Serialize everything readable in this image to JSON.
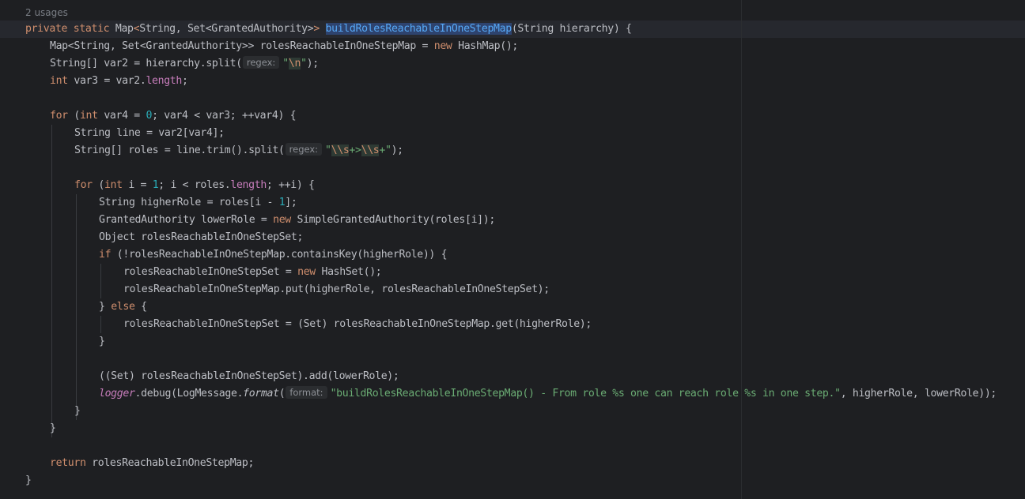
{
  "editor": {
    "usages_hint": "2 usages",
    "lines": [
      {
        "indent": 0,
        "segments": [
          {
            "t": "private",
            "c": "kw"
          },
          {
            "t": " "
          },
          {
            "t": "static",
            "c": "kw"
          },
          {
            "t": " Map"
          },
          {
            "t": "<",
            "c": "kw"
          },
          {
            "t": "String, Set<GrantedAuthority>"
          },
          {
            "t": ">",
            "c": "kw"
          },
          {
            "t": " "
          },
          {
            "t": "buildRolesReachableInOneStepMap",
            "c": "fn-hl"
          },
          {
            "t": "(String hierarchy) {"
          }
        ]
      },
      {
        "indent": 1,
        "segments": [
          {
            "t": "Map<String, Set<GrantedAuthority>> rolesReachableInOneStepMap = "
          },
          {
            "t": "new",
            "c": "kw"
          },
          {
            "t": " HashMap();"
          }
        ]
      },
      {
        "indent": 1,
        "segments": [
          {
            "t": "String[] var2 = hierarchy.split("
          },
          {
            "t": "regex:",
            "c": "hint"
          },
          {
            "t": "\"",
            "c": "str"
          },
          {
            "t": "\\n",
            "c": "esc"
          },
          {
            "t": "\"",
            "c": "str"
          },
          {
            "t": ");"
          }
        ]
      },
      {
        "indent": 1,
        "segments": [
          {
            "t": "int",
            "c": "kw"
          },
          {
            "t": " var3 = var2."
          },
          {
            "t": "length",
            "c": "fld"
          },
          {
            "t": ";"
          }
        ]
      },
      {
        "indent": 0,
        "segments": []
      },
      {
        "indent": 1,
        "segments": [
          {
            "t": "for",
            "c": "kw"
          },
          {
            "t": " ("
          },
          {
            "t": "int",
            "c": "kw"
          },
          {
            "t": " var4 = "
          },
          {
            "t": "0",
            "c": "num"
          },
          {
            "t": "; var4 < var3; ++var4) {"
          }
        ]
      },
      {
        "indent": 2,
        "segments": [
          {
            "t": "String line = var2[var4];"
          }
        ]
      },
      {
        "indent": 2,
        "segments": [
          {
            "t": "String[] roles = line.trim().split("
          },
          {
            "t": "regex:",
            "c": "hint"
          },
          {
            "t": "\"",
            "c": "str"
          },
          {
            "t": "\\\\s",
            "c": "esc"
          },
          {
            "t": "+>",
            "c": "str"
          },
          {
            "t": "\\\\s",
            "c": "esc"
          },
          {
            "t": "+\"",
            "c": "str"
          },
          {
            "t": ");"
          }
        ]
      },
      {
        "indent": 0,
        "segments": []
      },
      {
        "indent": 2,
        "segments": [
          {
            "t": "for",
            "c": "kw"
          },
          {
            "t": " ("
          },
          {
            "t": "int",
            "c": "kw"
          },
          {
            "t": " i = "
          },
          {
            "t": "1",
            "c": "num"
          },
          {
            "t": "; i < roles."
          },
          {
            "t": "length",
            "c": "fld"
          },
          {
            "t": "; ++i) {"
          }
        ]
      },
      {
        "indent": 3,
        "segments": [
          {
            "t": "String higherRole = roles[i - "
          },
          {
            "t": "1",
            "c": "num"
          },
          {
            "t": "];"
          }
        ]
      },
      {
        "indent": 3,
        "segments": [
          {
            "t": "GrantedAuthority lowerRole = "
          },
          {
            "t": "new",
            "c": "kw"
          },
          {
            "t": " SimpleGrantedAuthority(roles[i]);"
          }
        ]
      },
      {
        "indent": 3,
        "segments": [
          {
            "t": "Object rolesReachableInOneStepSet;"
          }
        ]
      },
      {
        "indent": 3,
        "segments": [
          {
            "t": "if",
            "c": "kw"
          },
          {
            "t": " (!rolesReachableInOneStepMap.containsKey(higherRole)) {"
          }
        ]
      },
      {
        "indent": 4,
        "segments": [
          {
            "t": "rolesReachableInOneStepSet = "
          },
          {
            "t": "new",
            "c": "kw"
          },
          {
            "t": " HashSet();"
          }
        ]
      },
      {
        "indent": 4,
        "segments": [
          {
            "t": "rolesReachableInOneStepMap.put(higherRole, rolesReachableInOneStepSet);"
          }
        ]
      },
      {
        "indent": 3,
        "segments": [
          {
            "t": "} "
          },
          {
            "t": "else",
            "c": "kw"
          },
          {
            "t": " {"
          }
        ]
      },
      {
        "indent": 4,
        "segments": [
          {
            "t": "rolesReachableInOneStepSet = (Set) rolesReachableInOneStepMap.get(higherRole);"
          }
        ]
      },
      {
        "indent": 3,
        "segments": [
          {
            "t": "}"
          }
        ]
      },
      {
        "indent": 0,
        "segments": []
      },
      {
        "indent": 3,
        "segments": [
          {
            "t": "((Set) rolesReachableInOneStepSet).add(lowerRole);"
          }
        ]
      },
      {
        "indent": 3,
        "segments": [
          {
            "t": "logger",
            "c": "sfld"
          },
          {
            "t": ".debug(LogMessage."
          },
          {
            "t": "format",
            "c": "ital"
          },
          {
            "t": "("
          },
          {
            "t": "format:",
            "c": "hint"
          },
          {
            "t": "\"buildRolesReachableInOneStepMap() - From role %s one can reach role %s in one step.\"",
            "c": "str"
          },
          {
            "t": ", higherRole, lowerRole));"
          }
        ]
      },
      {
        "indent": 2,
        "segments": [
          {
            "t": "}"
          }
        ]
      },
      {
        "indent": 1,
        "segments": [
          {
            "t": "}"
          }
        ]
      },
      {
        "indent": 0,
        "segments": []
      },
      {
        "indent": 1,
        "segments": [
          {
            "t": "return",
            "c": "kw"
          },
          {
            "t": " rolesReachableInOneStepMap;"
          }
        ]
      },
      {
        "indent": 0,
        "segments": [
          {
            "t": "}"
          }
        ]
      }
    ]
  }
}
